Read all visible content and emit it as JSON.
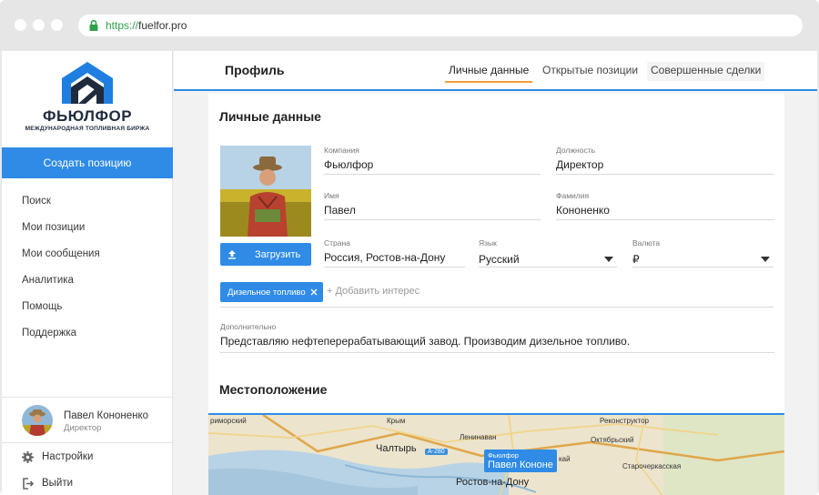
{
  "browser": {
    "url_scheme": "https://",
    "url_host": "fuelfor.pro"
  },
  "logo": {
    "name": "ФЬЮЛФОР",
    "subtitle": "МЕЖДУНАРОДНАЯ ТОПЛИВНАЯ БИРЖА"
  },
  "sidebar": {
    "create_label": "Создать позицию",
    "items": [
      {
        "label": "Поиск"
      },
      {
        "label": "Мои позиции"
      },
      {
        "label": "Мои сообщения"
      },
      {
        "label": "Аналитика"
      },
      {
        "label": "Помощь"
      },
      {
        "label": "Поддержка"
      }
    ],
    "user": {
      "name": "Павел Кононенко",
      "role": "Директор"
    },
    "settings_label": "Настройки",
    "logout_label": "Выйти"
  },
  "header": {
    "title": "Профиль",
    "tabs": [
      {
        "label": "Личные данные",
        "active": true
      },
      {
        "label": "Открытые позиции",
        "active": false
      },
      {
        "label": "Совершенные сделки",
        "active": false
      }
    ]
  },
  "personal": {
    "section_title": "Личные данные",
    "upload_label": "Загрузить",
    "company": {
      "label": "Компания",
      "value": "Фьюлфор"
    },
    "position": {
      "label": "Должность",
      "value": "Директор"
    },
    "first_name": {
      "label": "Имя",
      "value": "Павел"
    },
    "last_name": {
      "label": "Фамилия",
      "value": "Кононенко"
    },
    "country": {
      "label": "Страна",
      "value": "Россия, Ростов-на-Дону"
    },
    "language": {
      "label": "Язык",
      "value": "Русский"
    },
    "currency": {
      "label": "Валюта",
      "value": "₽"
    },
    "interests": [
      {
        "label": "Дизельное топливо"
      }
    ],
    "add_interest_label": "+ Добавить интерес",
    "additional": {
      "label": "Дополнительно",
      "value": "Представляю нефтеперерабатывающий завод. Производим дизельное топливо."
    }
  },
  "location": {
    "section_title": "Местоположение",
    "map_labels": {
      "primorsky": "риморский",
      "krym": "Крым",
      "leninavan": "Ленинаван",
      "reconstructor": "Реконструктор",
      "oktyabrsky": "Октябрьский",
      "chaltyr": "Чалтырь",
      "staro": "Старочеркасская",
      "rostov": "Ростов-на-Дону",
      "road": "A-280",
      "kai": "кай"
    },
    "marker_company": "Фьюлфор",
    "marker_name": "Павел Кононе"
  },
  "colors": {
    "accent": "#2f8be6",
    "tab_underline": "#f29d38",
    "lock": "#2fa14a"
  }
}
